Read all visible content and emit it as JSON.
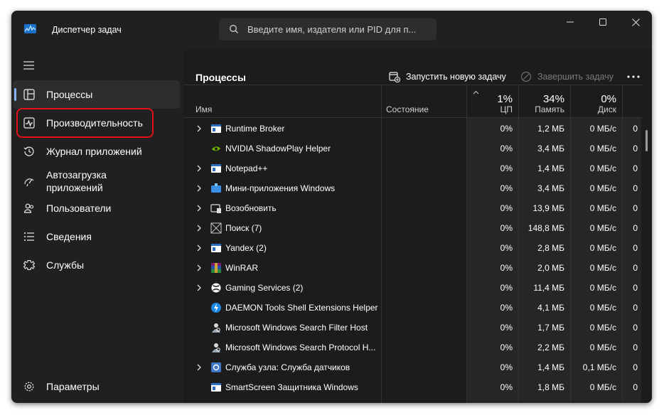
{
  "window": {
    "title": "Диспетчер задач"
  },
  "search": {
    "placeholder": "Введите имя, издателя или PID для п..."
  },
  "sidebar": {
    "items": [
      {
        "label": "Процессы",
        "icon": "processes-icon",
        "active": true
      },
      {
        "label": "Производительность",
        "icon": "performance-icon"
      },
      {
        "label": "Журнал приложений",
        "icon": "history-icon"
      },
      {
        "label": "Автозагрузка\nприложений",
        "icon": "startup-icon"
      },
      {
        "label": "Пользователи",
        "icon": "users-icon"
      },
      {
        "label": "Сведения",
        "icon": "details-icon"
      },
      {
        "label": "Службы",
        "icon": "services-icon"
      }
    ],
    "settings_label": "Параметры"
  },
  "main": {
    "title": "Процессы",
    "run_task_label": "Запустить новую задачу",
    "end_task_label": "Завершить задачу"
  },
  "columns": {
    "name": "Имя",
    "status": "Состояние",
    "cpu_pct": "1%",
    "cpu": "ЦП",
    "mem_pct": "34%",
    "mem": "Память",
    "disk_pct": "0%",
    "disk": "Диск"
  },
  "processes": [
    {
      "name": "Runtime Broker",
      "cpu": "0%",
      "mem": "1,2 МБ",
      "disk": "0 МБ/с",
      "net": "0",
      "expandable": true,
      "icon": "window-icon"
    },
    {
      "name": "NVIDIA ShadowPlay Helper",
      "cpu": "0%",
      "mem": "3,4 МБ",
      "disk": "0 МБ/с",
      "net": "0",
      "expandable": false,
      "icon": "nvidia-icon"
    },
    {
      "name": "Notepad++",
      "cpu": "0%",
      "mem": "1,4 МБ",
      "disk": "0 МБ/с",
      "net": "0",
      "expandable": true,
      "icon": "window-icon"
    },
    {
      "name": "Мини-приложения Windows",
      "cpu": "0%",
      "mem": "3,4 МБ",
      "disk": "0 МБ/с",
      "net": "0",
      "expandable": true,
      "icon": "widgets-icon"
    },
    {
      "name": "Возобновить",
      "cpu": "0%",
      "mem": "13,9 МБ",
      "disk": "0 МБ/с",
      "net": "0",
      "expandable": true,
      "icon": "resume-icon"
    },
    {
      "name": "Поиск (7)",
      "cpu": "0%",
      "mem": "148,8 МБ",
      "disk": "0 МБ/с",
      "net": "0",
      "expandable": true,
      "icon": "suspended-icon"
    },
    {
      "name": "Yandex (2)",
      "cpu": "0%",
      "mem": "2,8 МБ",
      "disk": "0 МБ/с",
      "net": "0",
      "expandable": true,
      "icon": "window-icon"
    },
    {
      "name": "WinRAR",
      "cpu": "0%",
      "mem": "2,0 МБ",
      "disk": "0 МБ/с",
      "net": "0",
      "expandable": true,
      "icon": "winrar-icon"
    },
    {
      "name": "Gaming Services (2)",
      "cpu": "0%",
      "mem": "11,4 МБ",
      "disk": "0 МБ/с",
      "net": "0",
      "expandable": true,
      "icon": "xbox-icon"
    },
    {
      "name": "DAEMON Tools Shell Extensions Helper",
      "cpu": "0%",
      "mem": "4,1 МБ",
      "disk": "0 МБ/с",
      "net": "0",
      "expandable": false,
      "icon": "daemon-tools-icon"
    },
    {
      "name": "Microsoft Windows Search Filter Host",
      "cpu": "0%",
      "mem": "1,7 МБ",
      "disk": "0 МБ/с",
      "net": "0",
      "expandable": false,
      "icon": "search-host-icon"
    },
    {
      "name": "Microsoft Windows Search Protocol H...",
      "cpu": "0%",
      "mem": "2,2 МБ",
      "disk": "0 МБ/с",
      "net": "0",
      "expandable": false,
      "icon": "search-host-icon"
    },
    {
      "name": "Служба узла: Служба датчиков",
      "cpu": "0%",
      "mem": "1,4 МБ",
      "disk": "0,1 МБ/с",
      "net": "0",
      "expandable": true,
      "icon": "service-host-icon"
    },
    {
      "name": "SmartScreen Защитника Windows",
      "cpu": "0%",
      "mem": "1,8 МБ",
      "disk": "0 МБ/с",
      "net": "0",
      "expandable": false,
      "icon": "window-icon"
    }
  ],
  "colors": {
    "accent": "#8ab4f8",
    "highlight": "#e3101a",
    "window_bg": "#202020"
  }
}
